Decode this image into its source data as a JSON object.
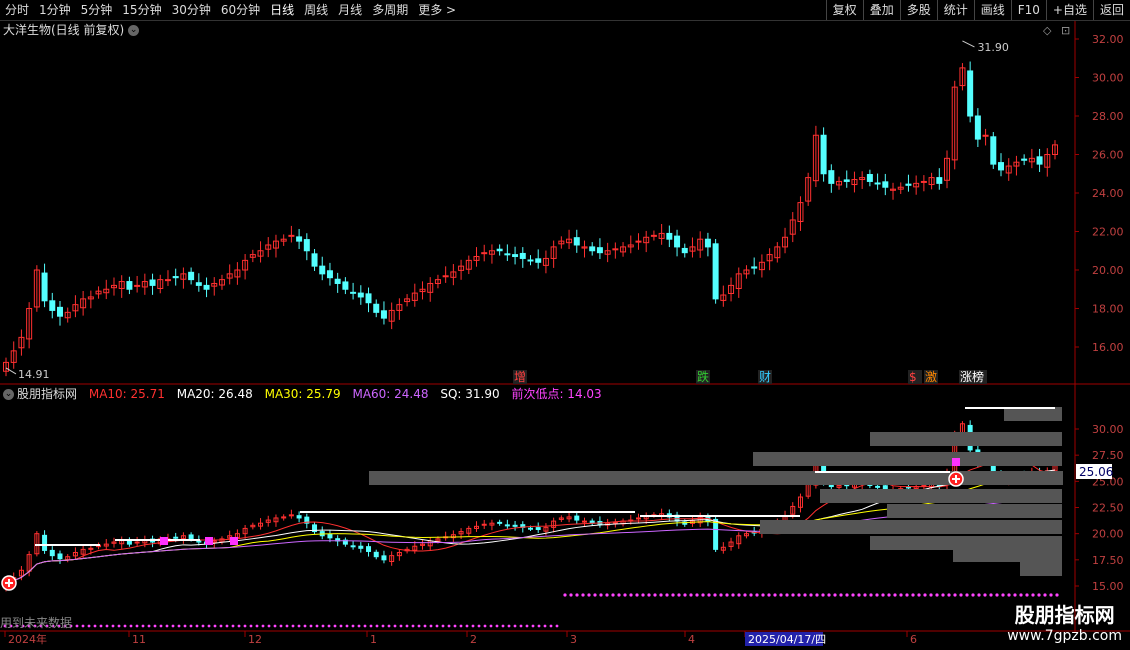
{
  "toolbar": {
    "periods": [
      "分时",
      "1分钟",
      "5分钟",
      "15分钟",
      "30分钟",
      "60分钟",
      "日线",
      "周线",
      "月线",
      "多周期",
      "更多 >"
    ],
    "active_period": "日线",
    "actions": [
      "复权",
      "叠加",
      "多股",
      "统计",
      "画线",
      "F10",
      "+自选",
      "返回"
    ],
    "colors": {
      "active": "#ffffff"
    }
  },
  "main_chart": {
    "title": "大洋生物(日线 前复权)",
    "y_ticks": [
      "32.00",
      "30.00",
      "28.00",
      "26.00",
      "24.00",
      "22.00",
      "20.00",
      "18.00",
      "16.00"
    ],
    "high_label": "31.90",
    "low_label": "14.91",
    "event_markers": [
      {
        "text": "增",
        "color": "#ff4040"
      },
      {
        "text": "跌",
        "color": "#33cc33"
      },
      {
        "text": "财",
        "color": "#33ccff"
      },
      {
        "text": "$",
        "color": "#ff4040"
      },
      {
        "text": "激",
        "color": "#ff8800"
      },
      {
        "text": "涨榜",
        "color": "#ffffff"
      }
    ],
    "colors": {
      "up": "#ff3030",
      "down": "#54ffff"
    }
  },
  "indicator": {
    "name": "股朋指标网",
    "ma10": {
      "label": "MA10: 25.71",
      "color": "#ff3030"
    },
    "ma20": {
      "label": "MA20: 26.48",
      "color": "#ffffff"
    },
    "ma30": {
      "label": "MA30: 25.79",
      "color": "#ffff00"
    },
    "ma60": {
      "label": "MA60: 24.48",
      "color": "#cc66ff"
    },
    "sq": {
      "label": "SQ: 31.90",
      "color": "#ffffff"
    },
    "next_low": {
      "label": "前次低点: 14.03",
      "color": "#ff44ff"
    },
    "y_ticks": [
      "30.00",
      "27.50",
      "25.00",
      "22.50",
      "20.00",
      "17.50",
      "15.00"
    ],
    "current_price": "25.06"
  },
  "x_axis": {
    "labels": [
      "2024年",
      "11",
      "12",
      "1",
      "2",
      "3",
      "4",
      "2025/04/17/四",
      "6"
    ]
  },
  "footer": {
    "notice": "用到未来数据",
    "watermark_1": "股朋指标网",
    "watermark_2": "www.7gpzb.com"
  },
  "chart_data": {
    "type": "candlestick",
    "title": "大洋生物(日线 前复权)",
    "y_range": [
      14.91,
      32.0
    ],
    "high": 31.9,
    "low": 14.91,
    "closes_approx": [
      15.2,
      15.8,
      16.5,
      18.0,
      20.0,
      18.4,
      17.9,
      17.6,
      17.8,
      18.2,
      18.5,
      18.6,
      18.9,
      19.0,
      19.2,
      19.4,
      19.0,
      19.2,
      19.4,
      19.2,
      19.5,
      19.5,
      19.6,
      19.8,
      19.5,
      19.2,
      19.0,
      19.3,
      19.5,
      19.8,
      20.0,
      20.5,
      20.8,
      21.0,
      21.3,
      21.5,
      21.6,
      21.8,
      21.5,
      21.0,
      20.2,
      19.8,
      19.6,
      19.3,
      19.0,
      18.8,
      18.6,
      18.3,
      17.8,
      17.5,
      17.9,
      18.2,
      18.5,
      18.8,
      19.0,
      19.3,
      19.5,
      19.7,
      19.9,
      20.2,
      20.5,
      20.7,
      20.9,
      21.0,
      21.0,
      20.8,
      20.7,
      20.6,
      20.5,
      20.4,
      20.6,
      21.2,
      21.5,
      21.6,
      21.3,
      21.2,
      21.0,
      20.9,
      21.0,
      21.1,
      21.2,
      21.3,
      21.5,
      21.7,
      21.8,
      21.9,
      21.6,
      21.2,
      20.9,
      21.2,
      21.6,
      21.2,
      18.5,
      18.7,
      19.2,
      19.8,
      20.0,
      20.1,
      20.4,
      20.8,
      21.2,
      21.7,
      22.6,
      23.5,
      24.8,
      27.0,
      25.0,
      24.5,
      24.6,
      24.6,
      24.7,
      24.8,
      24.6,
      24.5,
      24.3,
      24.2,
      24.3,
      24.4,
      24.5,
      24.6,
      24.8,
      24.5,
      25.8,
      29.5,
      30.5,
      28.0,
      26.8,
      27.0,
      25.5,
      25.2,
      25.4,
      25.6,
      25.7,
      25.8,
      25.5,
      26.0,
      26.5
    ],
    "ma_latest": {
      "MA10": 25.71,
      "MA20": 26.48,
      "MA30": 25.79,
      "MA60": 24.48
    },
    "SQ": 31.9,
    "next_low": 14.03
  }
}
